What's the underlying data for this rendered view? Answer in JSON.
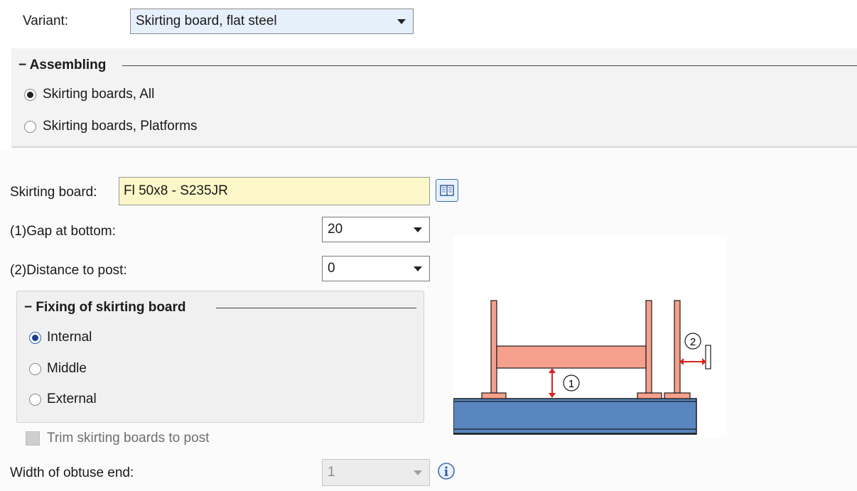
{
  "variant": {
    "label": "Variant:",
    "value": "Skirting board, flat steel"
  },
  "assembling": {
    "title": "Assembling",
    "options": [
      "Skirting boards, All",
      "Skirting boards, Platforms"
    ],
    "selected": 0
  },
  "skirting_board": {
    "label": "Skirting board:",
    "value": "Fl 50x8 - S235JR"
  },
  "gap_at_bottom": {
    "label": "(1)Gap at bottom:",
    "value": "20"
  },
  "distance_to_post": {
    "label": "(2)Distance to post:",
    "value": "0"
  },
  "fixing": {
    "title": "Fixing of skirting board",
    "options": [
      "Internal",
      "Middle",
      "External"
    ],
    "selected": 0
  },
  "trim": {
    "label": "Trim skirting boards to post",
    "checked": false,
    "enabled": false
  },
  "obtuse_end": {
    "label": "Width of obtuse end:",
    "value": "1",
    "enabled": false
  },
  "diagram": {
    "marker_1": "1",
    "marker_2": "2"
  },
  "colors": {
    "post": "#f4a08c",
    "beam": "#f4a08c",
    "deck": "#5a86c0",
    "arrow": "#e02020"
  }
}
